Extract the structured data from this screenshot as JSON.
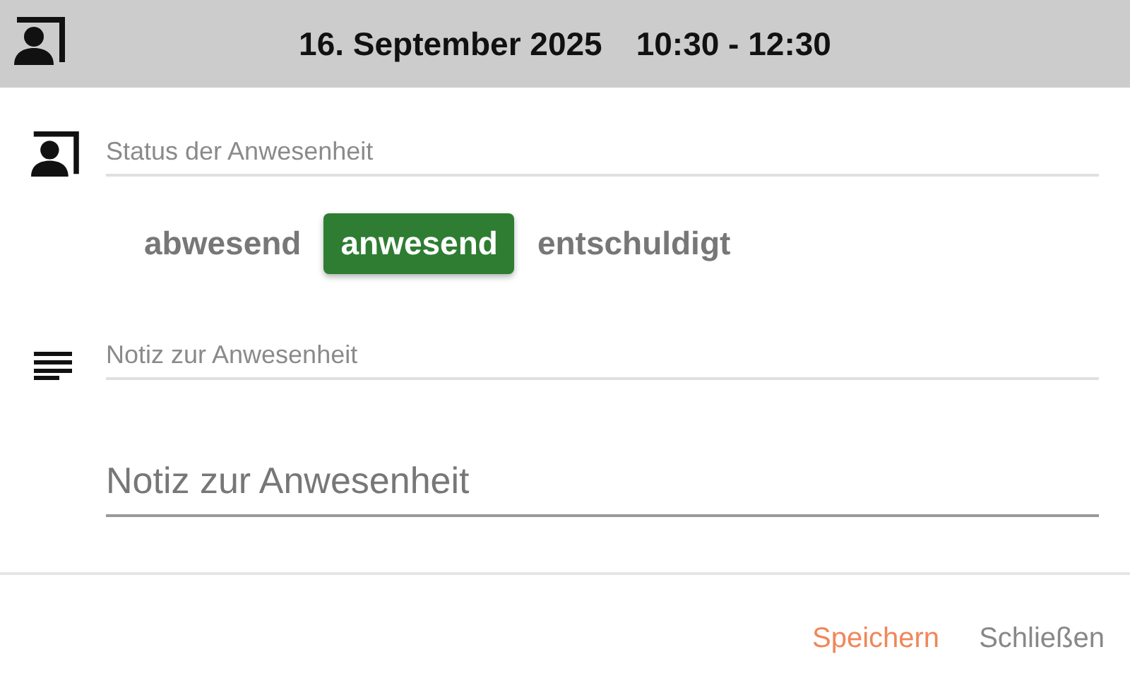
{
  "header": {
    "title": "16. September 2025",
    "time": "10:30 - 12:30"
  },
  "status_section": {
    "label": "Status der Anwesenheit",
    "options": [
      {
        "label": "abwesend",
        "selected": false
      },
      {
        "label": "anwesend",
        "selected": true
      },
      {
        "label": "entschuldigt",
        "selected": false
      }
    ]
  },
  "note_section": {
    "label": "Notiz zur Anwesenheit",
    "field": {
      "placeholder": "Notiz zur Anwesenheit"
    }
  },
  "buttons": [
    {
      "label": "Speichern",
      "kind": "primary"
    },
    {
      "label": "Schließen",
      "kind": "secondary"
    }
  ]
}
